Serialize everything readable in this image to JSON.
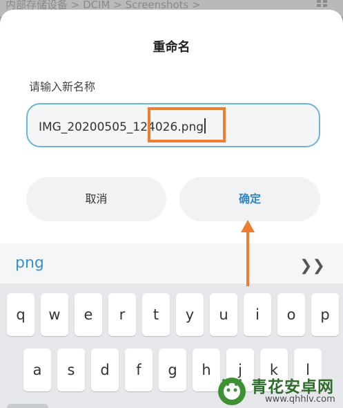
{
  "background": {
    "breadcrumb": "内部存储设备 > DCIM > Screenshots >",
    "grid_icon": "grid-icon"
  },
  "dialog": {
    "title": "重命名",
    "field_label": "请输入新名称",
    "input_value": "IMG_20200505_124026.png",
    "cancel_label": "取消",
    "confirm_label": "确定",
    "accent_color": "#2f87c8",
    "highlight_color": "#ed7d31"
  },
  "keyboard": {
    "suggestion": "png",
    "expand_icon": "double-chevron-right-icon",
    "row1": [
      "q",
      "w",
      "e",
      "r",
      "t",
      "y",
      "u",
      "i",
      "o",
      "p"
    ],
    "row2": [
      "a",
      "s",
      "d",
      "f",
      "g",
      "h",
      "j",
      "k",
      "l"
    ]
  },
  "watermark": {
    "title": "青花安卓网",
    "url": "www.qhhlv.com"
  }
}
